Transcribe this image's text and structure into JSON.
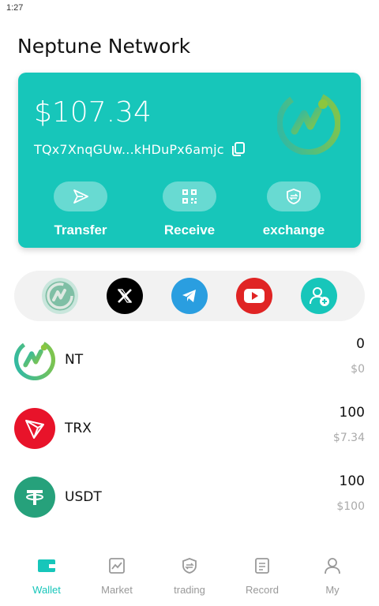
{
  "status_bar": {
    "time": "1:27"
  },
  "header": {
    "title": "Neptune Network"
  },
  "wallet": {
    "balance": "$107.34",
    "address": "TQx7XnqGUw...kHDuPx6amjc",
    "accent_color": "#17c6ba",
    "actions": [
      {
        "label": "Transfer",
        "icon": "send-icon"
      },
      {
        "label": "Receive",
        "icon": "qr-code-icon"
      },
      {
        "label": "exchange",
        "icon": "exchange-shield-icon"
      }
    ]
  },
  "social_links": [
    {
      "icon": "neptune-logo-icon"
    },
    {
      "icon": "x-icon"
    },
    {
      "icon": "telegram-icon"
    },
    {
      "icon": "youtube-icon"
    },
    {
      "icon": "add-contact-icon"
    }
  ],
  "tokens": [
    {
      "symbol": "NT",
      "amount": "0",
      "value": "$0",
      "icon": "nt-token-icon"
    },
    {
      "symbol": "TRX",
      "amount": "100",
      "value": "$7.34",
      "icon": "trx-token-icon"
    },
    {
      "symbol": "USDT",
      "amount": "100",
      "value": "$100",
      "icon": "usdt-token-icon"
    }
  ],
  "nav": [
    {
      "label": "Wallet",
      "icon": "wallet-icon",
      "active": true
    },
    {
      "label": "Market",
      "icon": "chart-icon",
      "active": false
    },
    {
      "label": "trading",
      "icon": "trading-shield-icon",
      "active": false
    },
    {
      "label": "Record",
      "icon": "record-icon",
      "active": false
    },
    {
      "label": "My",
      "icon": "user-icon",
      "active": false
    }
  ]
}
